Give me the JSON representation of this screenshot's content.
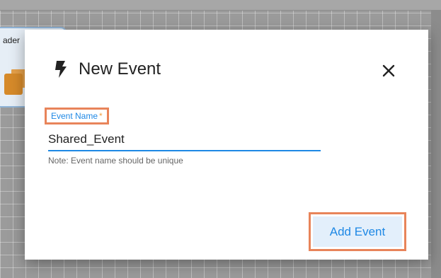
{
  "background": {
    "node_label": "ader"
  },
  "dialog": {
    "title": "New Event",
    "icon": "bolt-icon",
    "close_icon": "close-icon",
    "field": {
      "label": "Event Name",
      "required_mark": "*",
      "value": "Shared_Event",
      "note": "Note: Event name should be unique"
    },
    "add_button_label": "Add Event"
  },
  "colors": {
    "accent": "#1e88e5",
    "highlight": "#e8845a",
    "button_bg": "#e3effb",
    "required": "#f0a040"
  }
}
